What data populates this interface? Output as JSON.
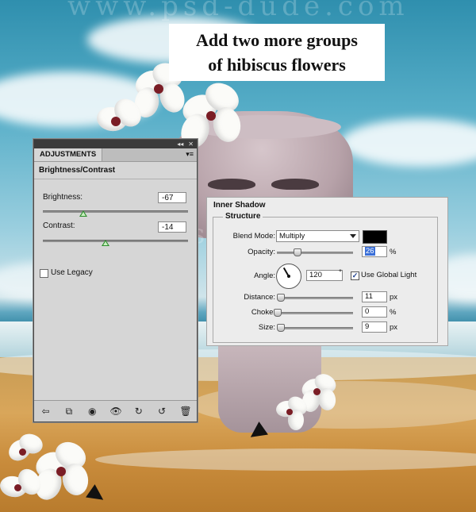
{
  "caption": {
    "line1": "Add two more groups",
    "line2": "of hibiscus flowers"
  },
  "watermark": "www.psd-dude.com",
  "adjustments": {
    "tab": "ADJUSTMENTS",
    "titlebar_icons": [
      "collapse-icon",
      "close-icon"
    ],
    "menu_icon": "panel-menu-icon",
    "subtitle": "Brightness/Contrast",
    "brightness_label": "Brightness:",
    "brightness_value": "-67",
    "brightness_level": 0.28,
    "contrast_label": "Contrast:",
    "contrast_value": "-14",
    "contrast_level": 0.43,
    "legacy_label": "Use Legacy",
    "legacy_checked": false,
    "footer_icons": [
      "return-icon",
      "clip-icon",
      "eye-preview-icon",
      "visibility-icon",
      "previous-state-icon",
      "reset-icon",
      "trash-icon"
    ]
  },
  "inner_shadow": {
    "title": "Inner Shadow",
    "group": "Structure",
    "blend_mode_label": "Blend Mode:",
    "blend_mode_value": "Multiply",
    "shadow_color": "#000000",
    "opacity_label": "Opacity:",
    "opacity_value": "26",
    "opacity_unit": "%",
    "opacity_level": 0.26,
    "angle_label": "Angle:",
    "angle_value": "120",
    "angle_unit": "°",
    "use_global_light_label": "Use Global Light",
    "use_global_light_checked": true,
    "distance_label": "Distance:",
    "distance_value": "11",
    "distance_unit": "px",
    "distance_level": 0.04,
    "choke_label": "Choke:",
    "choke_value": "0",
    "choke_unit": "%",
    "choke_level": 0.0,
    "size_label": "Size:",
    "size_value": "9",
    "size_unit": "px",
    "size_level": 0.04
  }
}
